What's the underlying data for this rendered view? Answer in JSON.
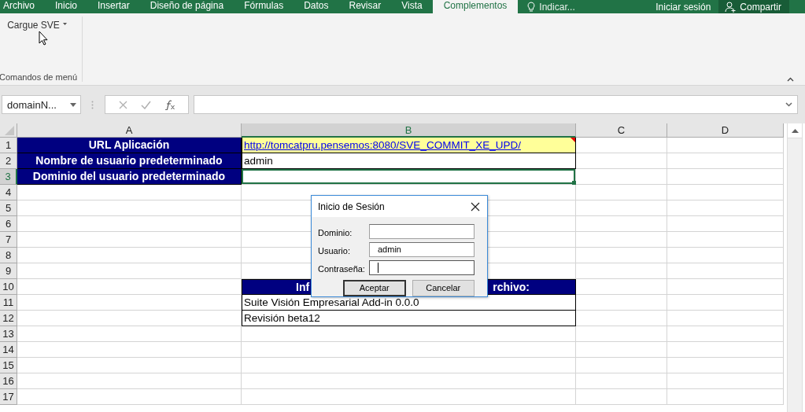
{
  "ribbon": {
    "tabs": [
      {
        "label": "Archivo",
        "selected": false
      },
      {
        "label": "Inicio",
        "selected": false
      },
      {
        "label": "Insertar",
        "selected": false
      },
      {
        "label": "Diseño de página",
        "selected": false
      },
      {
        "label": "Fórmulas",
        "selected": false
      },
      {
        "label": "Datos",
        "selected": false
      },
      {
        "label": "Revisar",
        "selected": false
      },
      {
        "label": "Vista",
        "selected": false
      },
      {
        "label": "Complementos",
        "selected": true
      }
    ],
    "tell_me": "Indicar...",
    "sign_in": "Iniciar sesión",
    "share": "Compartir",
    "groups": [
      {
        "button": "Cargue SVE",
        "label": "Comandos de menú"
      }
    ]
  },
  "formula_bar": {
    "name_box": "domainN..."
  },
  "sheet": {
    "columns": [
      {
        "label": "A",
        "selected": false
      },
      {
        "label": "B",
        "selected": true
      },
      {
        "label": "C",
        "selected": false
      },
      {
        "label": "D",
        "selected": false
      }
    ],
    "rows": [
      {
        "header": "1",
        "selected": false,
        "cells": [
          {
            "kind": "label",
            "text": "URL Aplicación"
          },
          {
            "kind": "link",
            "text": "http://tomcatpru.pensemos:8080/SVE_COMMIT_XE_UPD/",
            "comment": true
          }
        ]
      },
      {
        "header": "2",
        "selected": false,
        "cells": [
          {
            "kind": "label",
            "text": "Nombre de usuario predeterminado"
          },
          {
            "kind": "text",
            "text": "admin"
          }
        ]
      },
      {
        "header": "3",
        "selected": true,
        "cells": [
          {
            "kind": "label",
            "text": "Dominio del usuario predeterminado"
          },
          {
            "kind": "empty",
            "selected": true
          }
        ]
      },
      {
        "header": "4",
        "selected": false
      },
      {
        "header": "5",
        "selected": false
      },
      {
        "header": "6",
        "selected": false
      },
      {
        "header": "7",
        "selected": false
      },
      {
        "header": "8",
        "selected": false
      },
      {
        "header": "9",
        "selected": false
      },
      {
        "header": "10",
        "selected": false,
        "cells": [
          {
            "kind": "empty"
          },
          {
            "kind": "title",
            "text_left": "Inf",
            "text_right": "rchivo:"
          }
        ]
      },
      {
        "header": "11",
        "selected": false,
        "cells": [
          {
            "kind": "empty"
          },
          {
            "kind": "boxed",
            "text": "Suite Visión Empresarial Add-in 0.0.0"
          }
        ]
      },
      {
        "header": "12",
        "selected": false,
        "cells": [
          {
            "kind": "empty"
          },
          {
            "kind": "boxed",
            "text": "Revisión beta12"
          }
        ]
      },
      {
        "header": "13",
        "selected": false
      },
      {
        "header": "14",
        "selected": false
      },
      {
        "header": "15",
        "selected": false
      },
      {
        "header": "16",
        "selected": false
      },
      {
        "header": "17",
        "selected": false
      }
    ]
  },
  "dialog": {
    "title": "Inicio de Sesión",
    "fields": [
      {
        "label": "Dominio:",
        "focused": false
      },
      {
        "label": "Usuario:",
        "value": "admin",
        "focused": false
      },
      {
        "label": "Contraseña:",
        "focused": true
      }
    ],
    "buttons": [
      {
        "label": "Aceptar",
        "default": true
      },
      {
        "label": "Cancelar",
        "default": false
      }
    ]
  }
}
